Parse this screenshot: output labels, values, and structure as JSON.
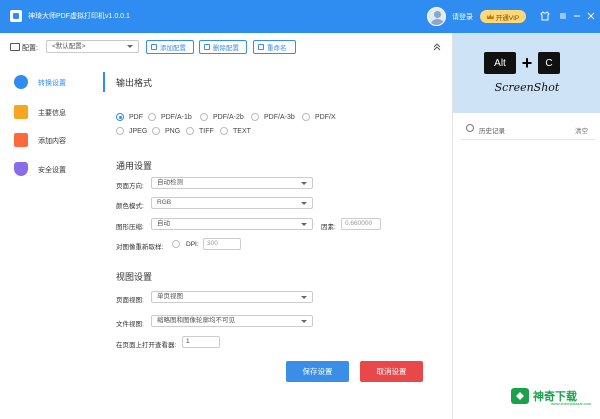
{
  "titlebar": {
    "app_title": "神琦大师PDF虚拟打印机v1.0.0.1",
    "login_text": "请登录",
    "vip_label": "开通VIP"
  },
  "toolbar": {
    "profile_label": "配置:",
    "profile_value": "<默认配置>",
    "add_label": "添加配置",
    "delete_label": "删除配置",
    "rename_label": "重命名"
  },
  "sidebar": {
    "items": [
      {
        "label": "转换设置",
        "icon": "convert-icon",
        "color": "#2f8cf0"
      },
      {
        "label": "主要信息",
        "icon": "info-icon",
        "color": "#f5a623"
      },
      {
        "label": "添加内容",
        "icon": "add-content-icon",
        "color": "#ff6a3d"
      },
      {
        "label": "安全设置",
        "icon": "shield-icon",
        "color": "#8a6de9"
      }
    ]
  },
  "output_format": {
    "title": "输出格式",
    "options": [
      "PDF",
      "PDF/A-1b",
      "PDF/A-2b",
      "PDF/A-3b",
      "PDF/X",
      "JPEG",
      "PNG",
      "TIFF",
      "TEXT"
    ],
    "selected": "PDF"
  },
  "general": {
    "title": "通用设置",
    "page_orientation_label": "页面方向:",
    "page_orientation_value": "自动检测",
    "color_mode_label": "颜色模式:",
    "color_mode_value": "RGB",
    "compression_label": "图形压缩:",
    "compression_value": "自动",
    "factor_label": "因素:",
    "factor_value": "0.660000",
    "resample_label": "对图像重新取样:",
    "dpi_label": "DPI:",
    "dpi_value": "300"
  },
  "view": {
    "title": "视图设置",
    "page_view_label": "页面视图:",
    "page_view_value": "单页视图",
    "doc_view_label": "文件视图:",
    "doc_view_value": "缩略图和图像轮廓均不可见",
    "open_page_label": "在页面上打开查看器:",
    "open_page_value": "1"
  },
  "actions": {
    "save_label": "保存设置",
    "cancel_label": "取消设置"
  },
  "right_panel": {
    "key_alt": "Alt",
    "key_plus": "+",
    "key_c": "C",
    "preview_text": "ScreenShot",
    "history_label": "历史记录",
    "clear_label": "清空"
  },
  "watermark": {
    "text": "神奇下载",
    "sub": "www.shenqixiazai.com"
  },
  "colors": {
    "accent": "#2f8cf0",
    "danger": "#e8484a",
    "vip": "#ffd978"
  }
}
